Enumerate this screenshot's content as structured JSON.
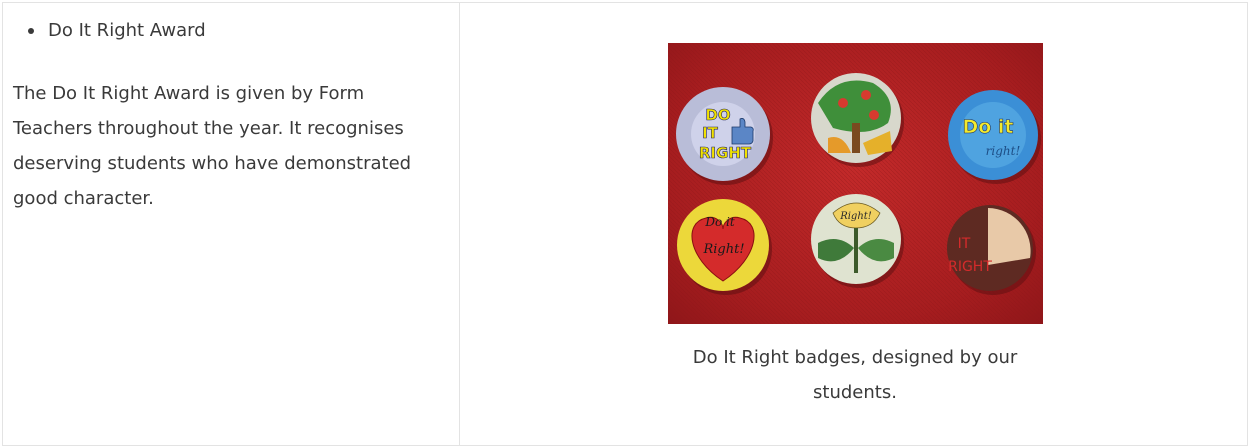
{
  "left_cell": {
    "list_items": [
      "Do It Right Award"
    ],
    "description": "The Do It Right Award is given by Form Teachers throughout the year. It recognises deserving students who have demonstrated good character."
  },
  "right_cell": {
    "caption": "Do It Right badges, designed by our students."
  },
  "photo_badges": {
    "badge1": {
      "text_lines": [
        "DO",
        "IT",
        "RIGHT"
      ]
    },
    "badge3": {
      "text_lines": [
        "Do it",
        "right!"
      ]
    },
    "badge4": {
      "text_lines": [
        "Do it",
        "Right!"
      ]
    },
    "badge5": {
      "text_lines": [
        "Right!"
      ]
    },
    "badge6": {
      "text_lines": [
        "IT",
        "RIGHT"
      ]
    }
  },
  "colors": {
    "text": "#3a3a3a",
    "border": "#e3e3e3",
    "photo_background": "#a61d1f"
  }
}
